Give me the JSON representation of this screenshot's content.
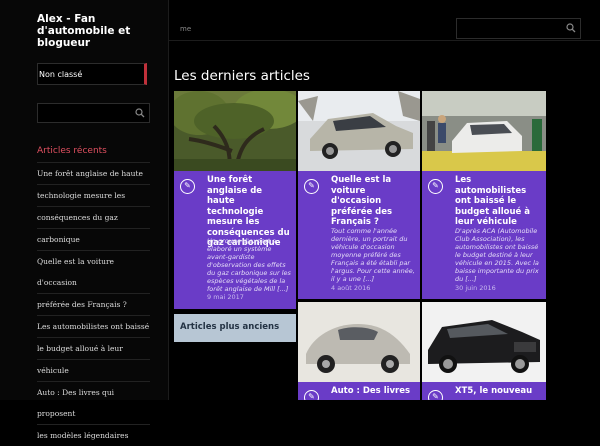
{
  "site": {
    "title": "Alex - Fan d'automobile et blogueur"
  },
  "sidebar": {
    "category_menu": "Non classé",
    "search_placeholder": "",
    "recent_title": "Articles récents",
    "recent_items": [
      "Une forêt anglaise de haute",
      "technologie mesure les",
      "conséquences du gaz",
      "carbonique",
      "Quelle est la voiture d'occasion",
      "préférée des Français ?",
      "Les automobilistes ont baissé",
      "le budget alloué à leur",
      "véhicule",
      "Auto : Des livres qui proposent",
      "les modèles légendaires"
    ]
  },
  "topbar": {
    "crumb": "me",
    "search_placeholder": ""
  },
  "main": {
    "heading": "Les derniers articles",
    "older_link": "Articles plus anciens",
    "cards": [
      {
        "thumb": "forest-photo",
        "title": "Une forêt anglaise de haute technologie mesure les conséquences du gaz carbonique",
        "excerpt": "Un groupe d'expert a élaboré un système avant-gardiste d'observation des effets du gaz carbonique sur les espèces végétales de la forêt anglaise de Mill [...]",
        "date": "9 mai 2017"
      },
      {
        "thumb": "silver-sedan-photo",
        "title": "Quelle est la voiture d'occasion préférée des Français ?",
        "excerpt": "Tout comme l'année dernière, un portrait du véhicule d'occasion moyenne préféré des Français a été établi par l'argus. Pour cette année, il y a une [...]",
        "date": "4 août 2016"
      },
      {
        "thumb": "car-factory-photo",
        "title": "Les automobilistes ont baissé le budget alloué à leur véhicule",
        "excerpt": "D'après ACA (Automobile Club Association), les automobilistes ont baissé le budget destiné à leur véhicule en 2015. Avec la baisse importante du prix du [...]",
        "date": "30 juin 2016"
      },
      {
        "thumb": "classic-porsche-photo",
        "title": "Auto : Des livres",
        "excerpt": "",
        "date": ""
      },
      {
        "thumb": "black-suv-photo",
        "title": "XT5, le nouveau",
        "excerpt": "",
        "date": ""
      }
    ]
  },
  "colors": {
    "accent": "#6a3cc7",
    "menu_bar": "#c0303a",
    "recent_title": "#e05060"
  }
}
